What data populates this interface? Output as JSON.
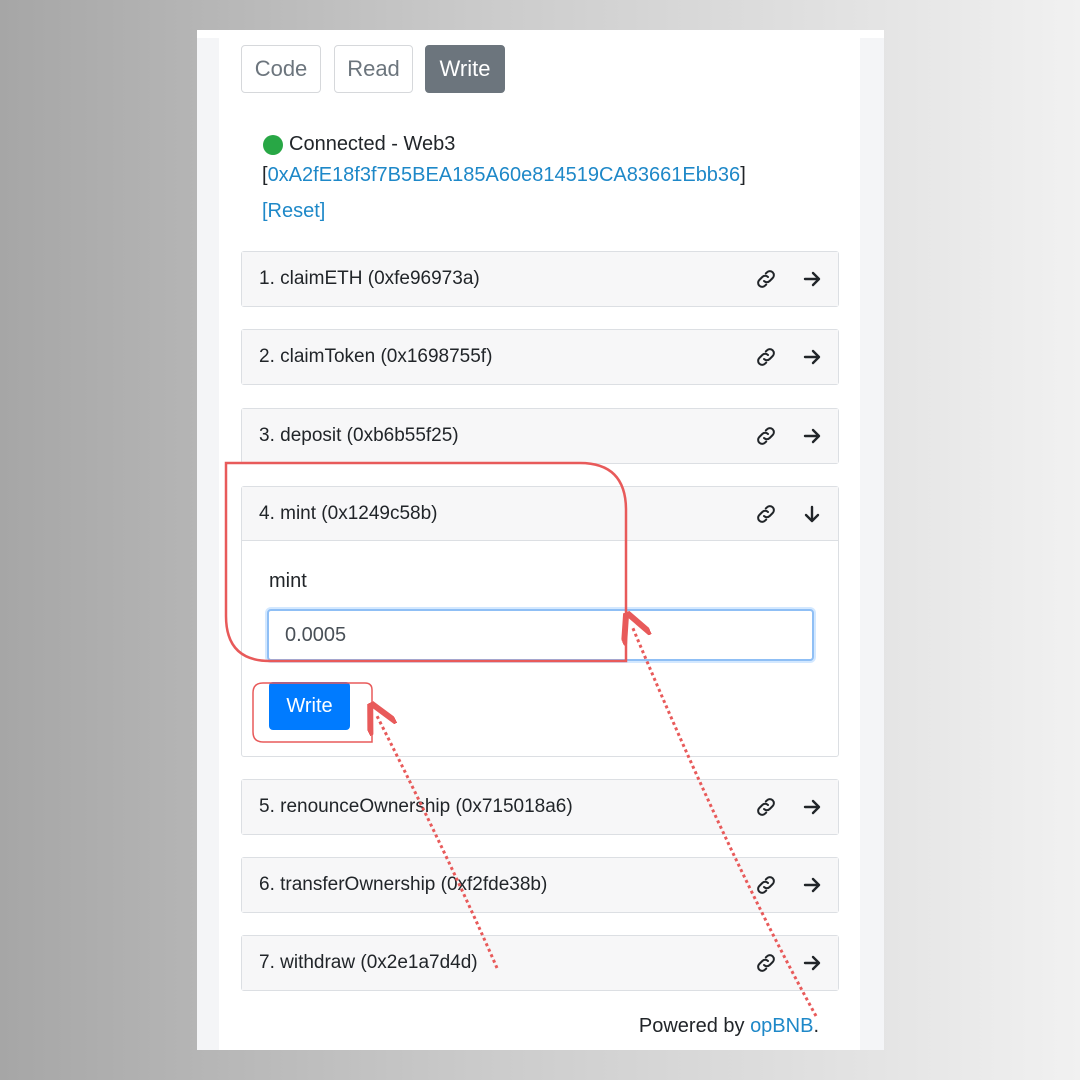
{
  "tabs": [
    {
      "label": "Code"
    },
    {
      "label": "Read"
    },
    {
      "label": "Write",
      "active": true
    }
  ],
  "connection": {
    "status": "Connected - Web3",
    "bracket_open": "[",
    "address": "0xA2fE18f3f7B5BEA185A60e814519CA83661Ebb36",
    "bracket_close": "]",
    "reset_label": "[Reset]"
  },
  "functions": [
    {
      "label": "1. claimETH (0xfe96973a)"
    },
    {
      "label": "2. claimToken (0x1698755f)"
    },
    {
      "label": "3. deposit (0xb6b55f25)"
    },
    {
      "label": "4. mint (0x1249c58b)"
    },
    {
      "label": "5. renounceOwnership (0x715018a6)"
    },
    {
      "label": "6. transferOwnership (0xf2fde38b)"
    },
    {
      "label": "7. withdraw (0x2e1a7d4d)"
    }
  ],
  "mint_form": {
    "field_label": "mint",
    "field_value": "0.0005",
    "write_label": "Write"
  },
  "footer": {
    "powered_text": "Powered by ",
    "powered_link": "opBNB",
    "period": "."
  },
  "colors": {
    "accent": "#007bff",
    "link": "#1e88c8",
    "connected": "#28a745",
    "annotation": "#e85a5a"
  },
  "icons": [
    "link-icon",
    "arrow-right-icon",
    "arrow-down-icon",
    "status-dot-icon"
  ]
}
